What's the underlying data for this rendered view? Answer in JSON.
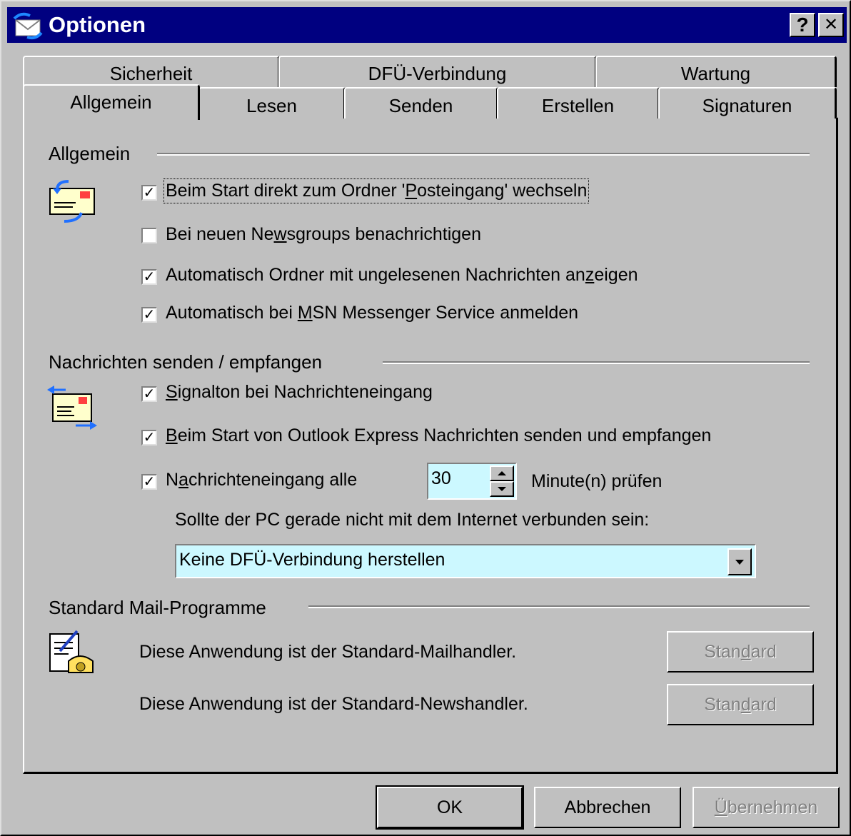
{
  "window": {
    "title": "Optionen",
    "help_label": "?",
    "close_label": "✕"
  },
  "tabs_back": [
    {
      "label": "Sicherheit"
    },
    {
      "label": "DFÜ-Verbindung"
    },
    {
      "label": "Wartung"
    }
  ],
  "tabs_front": [
    {
      "label": "Allgemein",
      "selected": true
    },
    {
      "label": "Lesen"
    },
    {
      "label": "Senden"
    },
    {
      "label": "Erstellen"
    },
    {
      "label": "Signaturen"
    }
  ],
  "general": {
    "title": "Allgemein",
    "icon": "mail-folder-icon",
    "options": [
      {
        "pre": "Beim Start direkt zum Ordner '",
        "u": "P",
        "post": "osteingang' wechseln",
        "checked": true
      },
      {
        "pre": "Bei neuen Ne",
        "u": "w",
        "post": "sgroups benachrichtigen",
        "checked": false
      },
      {
        "pre": "Automatisch Ordner mit ungelesenen Nachrichten an",
        "u": "z",
        "post": "eigen",
        "checked": true
      },
      {
        "pre": "Automatisch bei ",
        "u": "M",
        "post": "SN Messenger Service anmelden",
        "checked": true
      }
    ]
  },
  "send_receive": {
    "title": "Nachrichten senden / empfangen",
    "icon": "send-receive-icon",
    "options": [
      {
        "pre": "",
        "u": "S",
        "post": "ignalton bei Nachrichteneingang",
        "checked": true
      },
      {
        "pre": "",
        "u": "B",
        "post": "eim Start von Outlook Express Nachrichten senden und empfangen",
        "checked": true
      },
      {
        "pre": "N",
        "u": "a",
        "post": "chrichteneingang alle",
        "checked": true
      }
    ],
    "interval_value": "30",
    "interval_suffix": "Minute(n) prüfen",
    "offline_label": "Sollte der PC gerade nicht mit dem Internet verbunden sein:",
    "offline_selected": "Keine DFÜ-Verbindung herstellen"
  },
  "default_programs": {
    "title": "Standard Mail-Programme",
    "icon": "mail-phone-icon",
    "mail_text": "Diese Anwendung ist der Standard-Mailhandler.",
    "news_text": "Diese Anwendung ist der Standard-Newshandler.",
    "button_pre": "Stan",
    "button_u": "d",
    "button_post": "ard"
  },
  "footer": {
    "ok": "OK",
    "cancel": "Abbrechen",
    "apply_u": "Ü",
    "apply_post": "bernehmen"
  },
  "colors": {
    "titlebar": "#000080",
    "face": "#c0c0c0",
    "field": "#ccf8ff"
  }
}
